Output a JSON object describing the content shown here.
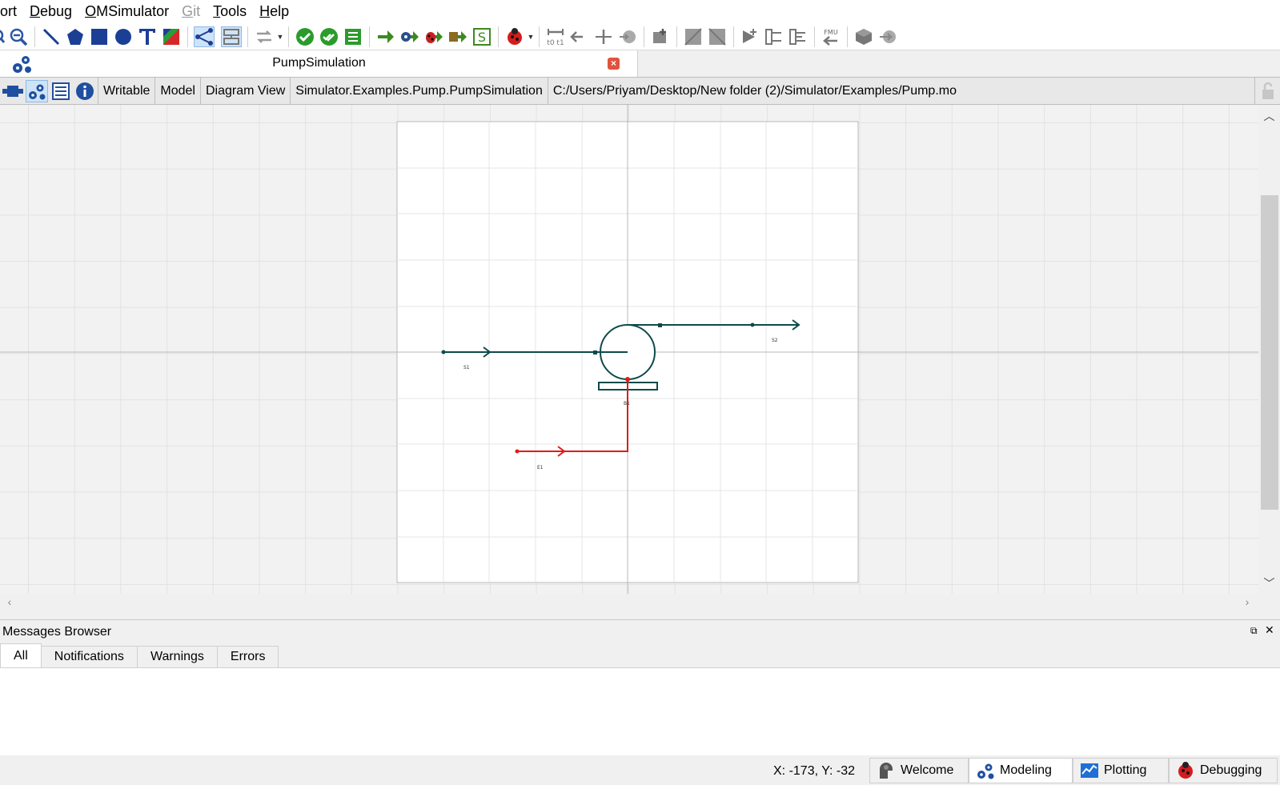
{
  "menu": {
    "items": [
      {
        "label": "ort",
        "accel": ""
      },
      {
        "label": "Debug",
        "accel": "D"
      },
      {
        "label": "OMSimulator",
        "accel": "O"
      },
      {
        "label": "Git",
        "accel": "G"
      },
      {
        "label": "Tools",
        "accel": "T"
      },
      {
        "label": "Help",
        "accel": "H"
      }
    ],
    "l0": "ort",
    "d_first": "D",
    "d_rest": "ebug",
    "o_first": "O",
    "o_rest": "MSimulator",
    "g_first": "G",
    "g_rest": "it",
    "t_first": "T",
    "t_rest": "ools",
    "h_first": "H",
    "h_rest": "elp"
  },
  "document_tab": {
    "title": "PumpSimulation",
    "close_label": "×"
  },
  "info_bar": {
    "access": "Writable",
    "restriction": "Model",
    "view": "Diagram View",
    "class_path": "Simulator.Examples.Pump.PumpSimulation",
    "file_path": "C:/Users/Priyam/Desktop/New folder (2)/Simulator/Examples/Pump.mo"
  },
  "diagram": {
    "labels": {
      "inlet_stream": "S1",
      "outlet_stream": "S2",
      "pump": "B1",
      "energy_stream": "E1"
    },
    "colors": {
      "material_stream": "#0e4a4a",
      "energy_stream": "#e01b1b",
      "canvas": "#ffffff"
    }
  },
  "messages": {
    "title": "Messages Browser",
    "float_label": "⧉",
    "close_label": "✕",
    "tabs": [
      "All",
      "Notifications",
      "Warnings",
      "Errors"
    ],
    "active_tab": "All"
  },
  "status": {
    "coordinates": "X: -173, Y: -32",
    "perspectives": [
      "Welcome",
      "Modeling",
      "Plotting",
      "Debugging"
    ],
    "active_perspective": "Modeling"
  },
  "icons": {
    "toolbar": [
      "zoom-out-icon",
      "line-icon",
      "polygon-icon",
      "rectangle-icon",
      "ellipse-icon",
      "text-icon",
      "bitmap-icon",
      "connect-mode-icon",
      "transition-mode-icon",
      "reset-icon",
      "check-model-icon",
      "check-all-icon",
      "instantiate-icon",
      "simulate-icon",
      "simulate-transformational-icon",
      "simulate-algorithmic-icon",
      "simulate-animation-icon",
      "simulation-setup-icon",
      "debug-icon",
      "time-range-icon",
      "align-left-icon",
      "align-center-icon",
      "fmu-import-icon",
      "ssp-add-icon",
      "ssp-bus-icon",
      "ssp-bus2-icon",
      "ssp-connector-icon",
      "ssp-export-icon",
      "ssp-tlm-icon",
      "fmu-export-icon",
      "package-icon",
      "arrow-right-icon"
    ]
  }
}
